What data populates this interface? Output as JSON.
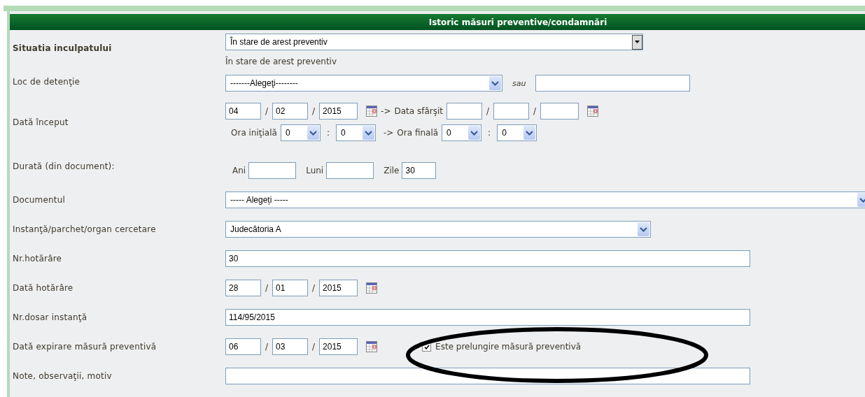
{
  "title": "Istoric măsuri preventive/condamnări",
  "rows": [
    {
      "kind": "select_note",
      "label": "Situatia inculpatului",
      "value": "În stare de arest preventiv",
      "note": "În stare de arest preventiv"
    },
    {
      "kind": "select_or",
      "label": "Loc de detenţie",
      "value": "-------Alegeţi--------",
      "or_text": "sau"
    },
    {
      "kind": "date_range",
      "label": "Dată început",
      "start": {
        "day": "04",
        "month": "02",
        "year": "2015",
        "separator": "/"
      },
      "arrow": "->",
      "end_label": "Data sfârşit",
      "end": {
        "separator": "/"
      },
      "time": {
        "start_label": "Ora iniţială",
        "start_hour": "0",
        "start_minute": "0",
        "separator": ":",
        "arrow": "->",
        "end_label": "Ora finală",
        "end_hour": "0",
        "end_minute": "0"
      }
    },
    {
      "kind": "duration",
      "label": "Durată (din document):",
      "parts": [
        {
          "label": "Ani"
        },
        {
          "label": "Luni"
        },
        {
          "label": "Zile",
          "value": "30"
        }
      ]
    },
    {
      "kind": "select_wide",
      "label": "Documentul",
      "value": "----- Alegeți -----"
    },
    {
      "kind": "select",
      "label": "Instanţă/parchet/organ cercetare",
      "value": "Judecătoria A"
    },
    {
      "kind": "text",
      "label": "Nr.hotărâre",
      "value": "30"
    },
    {
      "kind": "date",
      "label": "Dată hotărâre",
      "date": {
        "day": "28",
        "month": "01",
        "year": "2015",
        "separator": "/"
      }
    },
    {
      "kind": "text",
      "label": "Nr.dosar instanţă",
      "value": "114/95/2015"
    },
    {
      "kind": "date_check",
      "label": "Dată expirare măsură preventivă",
      "date": {
        "day": "06",
        "month": "03",
        "year": "2015",
        "separator": "/"
      },
      "check": {
        "label": "Este prelungire măsură preventivă",
        "checked": true
      }
    },
    {
      "kind": "text",
      "label": "Note, observaţii, motiv"
    }
  ]
}
